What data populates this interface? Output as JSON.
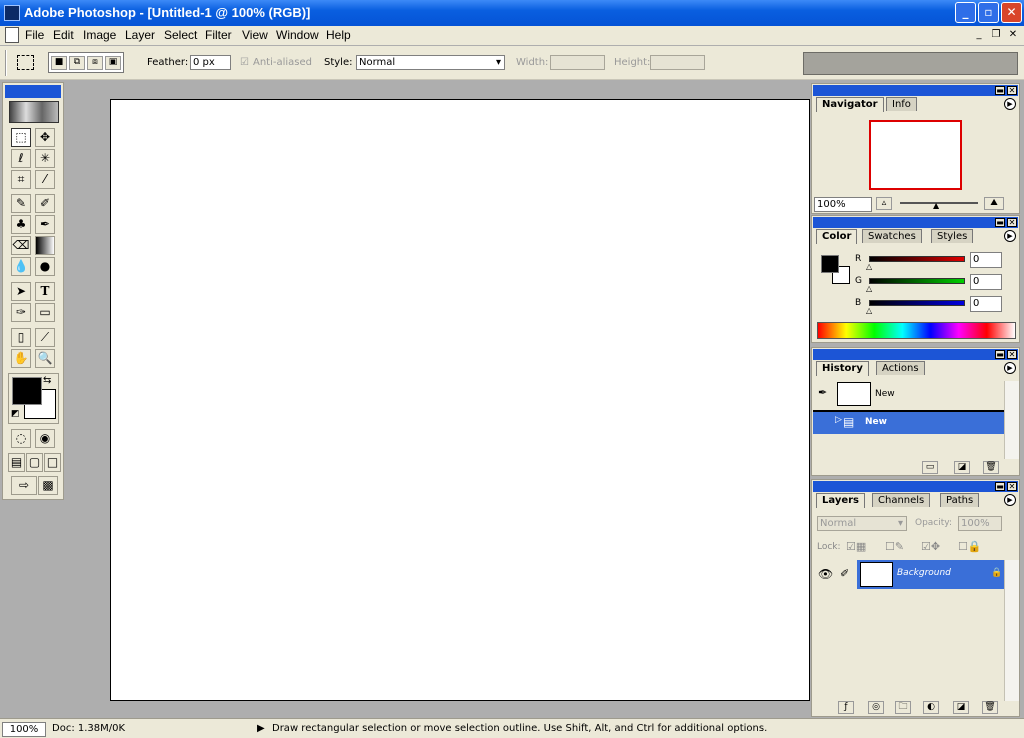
{
  "window": {
    "title": "Adobe Photoshop - [Untitled-1 @ 100% (RGB)]",
    "minimize": "_",
    "restore": "▫",
    "close": "✕"
  },
  "menu": [
    "File",
    "Edit",
    "Image",
    "Layer",
    "Select",
    "Filter",
    "View",
    "Window",
    "Help"
  ],
  "options": {
    "feather_label": "Feather:",
    "feather_value": "0 px",
    "antialiased_label": "Anti-aliased",
    "style_label": "Style:",
    "style_value": "Normal",
    "width_label": "Width:",
    "height_label": "Height:"
  },
  "navigator": {
    "tabs": [
      "Navigator",
      "Info"
    ],
    "zoom": "100%"
  },
  "color": {
    "tabs": [
      "Color",
      "Swatches",
      "Styles"
    ],
    "channels": [
      {
        "label": "R",
        "value": "0",
        "color": "#c00000"
      },
      {
        "label": "G",
        "value": "0",
        "color": "#00a000"
      },
      {
        "label": "B",
        "value": "0",
        "color": "#0000c0"
      }
    ]
  },
  "history": {
    "tabs": [
      "History",
      "Actions"
    ],
    "snapshot_label": "New",
    "state_label": "New"
  },
  "layers": {
    "tabs": [
      "Layers",
      "Channels",
      "Paths"
    ],
    "blend_mode": "Normal",
    "opacity_label": "Opacity:",
    "opacity_value": "100%",
    "lock_label": "Lock:",
    "layer_name": "Background"
  },
  "status": {
    "zoom": "100%",
    "doc": "Doc: 1.38M/0K",
    "hint": "Draw rectangular selection or move selection outline.  Use Shift, Alt, and Ctrl for additional options."
  },
  "colors": {
    "title_blue": "#0553d6",
    "panel_bg": "#ece9d8",
    "selected_blue": "#3a6fd8"
  }
}
